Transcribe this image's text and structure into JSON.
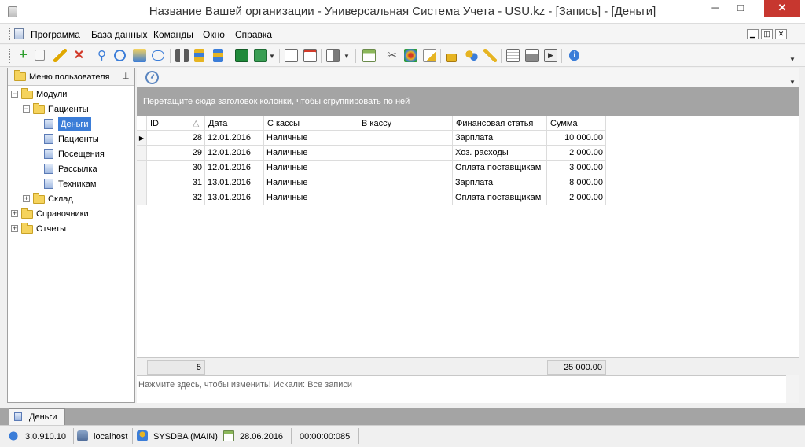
{
  "window": {
    "title": "Название Вашей организации - Универсальная Система Учета - USU.kz - [Запись] - [Деньги]",
    "minimize": "─",
    "maximize": "□",
    "close": "✕"
  },
  "menu": {
    "items": [
      "Программа",
      "База данных",
      "Команды",
      "Окно",
      "Справка"
    ],
    "mdi_buttons": [
      "▁",
      "◫",
      "✕"
    ]
  },
  "toolbar": {
    "icons": [
      "add-icon",
      "copy-icon",
      "edit-icon",
      "delete-icon",
      "search-icon",
      "refresh-icon",
      "filter-icon",
      "comment-icon",
      "binoculars-icon",
      "sort-asc-icon",
      "sort-desc-icon",
      "export-excel-icon",
      "import-icon",
      "window-new-icon",
      "window-close-icon",
      "exit-icon",
      "calendar-icon",
      "tools-icon",
      "palette-icon",
      "edit-note-icon",
      "lock-icon",
      "users-icon",
      "key-icon",
      "table-icon",
      "print-icon",
      "play-icon",
      "info-icon"
    ],
    "colors": {
      "add": "#2e9e2e",
      "delete": "#d23a2a",
      "accent": "#3b7dd8"
    }
  },
  "user_menu": {
    "header": "Меню пользователя",
    "pin": "⊥",
    "tree": [
      {
        "label": "Модули",
        "level": 0,
        "expander": "−",
        "icon": "folder"
      },
      {
        "label": "Пациенты",
        "level": 1,
        "expander": "−",
        "icon": "folder"
      },
      {
        "label": "Деньги",
        "level": 2,
        "expander": "",
        "icon": "doc",
        "selected": true
      },
      {
        "label": "Пациенты",
        "level": 2,
        "expander": "",
        "icon": "doc"
      },
      {
        "label": "Посещения",
        "level": 2,
        "expander": "",
        "icon": "doc"
      },
      {
        "label": "Рассылка",
        "level": 2,
        "expander": "",
        "icon": "doc"
      },
      {
        "label": "Техникам",
        "level": 2,
        "expander": "",
        "icon": "doc"
      },
      {
        "label": "Склад",
        "level": 1,
        "expander": "+",
        "icon": "folder"
      },
      {
        "label": "Справочники",
        "level": 0,
        "expander": "+",
        "icon": "folder"
      },
      {
        "label": "Отчеты",
        "level": 0,
        "expander": "+",
        "icon": "folder"
      }
    ]
  },
  "grid": {
    "group_panel_text": "Перетащите сюда заголовок колонки, чтобы сгруппировать по ней",
    "columns": [
      "ID",
      "Дата",
      "С кассы",
      "В кассу",
      "Финансовая статья",
      "Сумма"
    ],
    "sort_indicator": "△",
    "current_row_marker": "▶",
    "rows": [
      {
        "id": "28",
        "date": "12.01.2016",
        "from": "Наличные",
        "to": "",
        "article": "Зарплата",
        "sum": "10 000.00"
      },
      {
        "id": "29",
        "date": "12.01.2016",
        "from": "Наличные",
        "to": "",
        "article": "Хоз. расходы",
        "sum": "2 000.00"
      },
      {
        "id": "30",
        "date": "12.01.2016",
        "from": "Наличные",
        "to": "",
        "article": "Оплата поставщикам",
        "sum": "3 000.00"
      },
      {
        "id": "31",
        "date": "13.01.2016",
        "from": "Наличные",
        "to": "",
        "article": "Зарплата",
        "sum": "8 000.00"
      },
      {
        "id": "32",
        "date": "13.01.2016",
        "from": "Наличные",
        "to": "",
        "article": "Оплата поставщикам",
        "sum": "2 000.00"
      }
    ],
    "footer_count": "5",
    "footer_total": "25 000.00",
    "filter_text": "Нажмите здесь, чтобы изменить! Искали: Все записи"
  },
  "tabs": [
    {
      "label": "Деньги"
    }
  ],
  "status": {
    "version": "3.0.910.10",
    "host": "localhost",
    "user": "SYSDBA (MAIN)",
    "date": "28.06.2016",
    "timer": "00:00:00:085"
  }
}
